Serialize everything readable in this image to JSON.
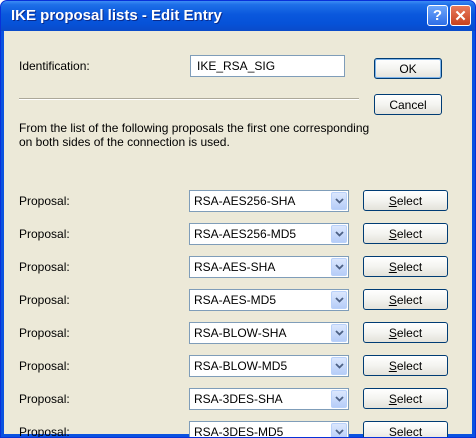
{
  "window": {
    "title": "IKE proposal lists - Edit Entry",
    "help_label": "?",
    "close_label": "✕"
  },
  "identification": {
    "label": "Identification:",
    "value": "IKE_RSA_SIG"
  },
  "buttons": {
    "ok": "OK",
    "cancel": "Cancel",
    "select_first": "S",
    "select_rest": "elect"
  },
  "info_text": "From the list of the following proposals the first one corresponding on both sides of the connection is used.",
  "proposals": [
    {
      "label": "Proposal:",
      "value": "RSA-AES256-SHA"
    },
    {
      "label": "Proposal:",
      "value": "RSA-AES256-MD5"
    },
    {
      "label": "Proposal:",
      "value": "RSA-AES-SHA"
    },
    {
      "label": "Proposal:",
      "value": "RSA-AES-MD5"
    },
    {
      "label": "Proposal:",
      "value": "RSA-BLOW-SHA"
    },
    {
      "label": "Proposal:",
      "value": "RSA-BLOW-MD5"
    },
    {
      "label": "Proposal:",
      "value": "RSA-3DES-SHA"
    },
    {
      "label": "Proposal:",
      "value": "RSA-3DES-MD5"
    }
  ],
  "colors": {
    "titlebar": "#0a58dd",
    "dialog_bg": "#ece9d8",
    "field_border": "#7f9db9"
  }
}
